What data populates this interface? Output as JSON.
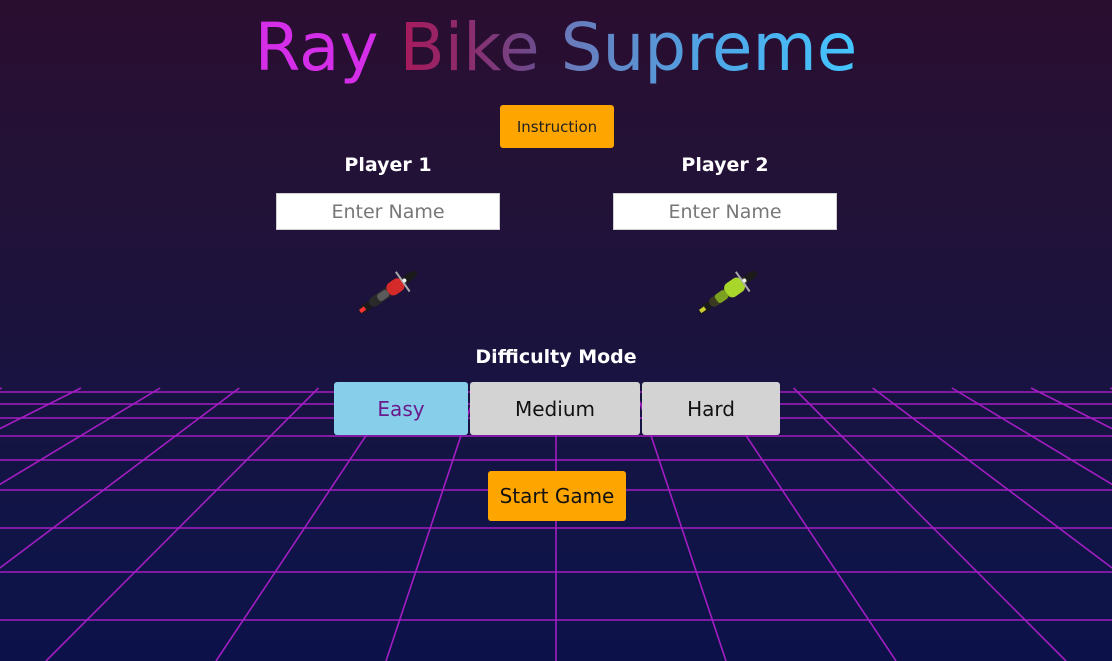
{
  "title": {
    "word1": "Ray",
    "word2": "Bike",
    "word3": "Supreme"
  },
  "instruction_button": "Instruction",
  "players": [
    {
      "label": "Player 1",
      "name_placeholder": "Enter Name",
      "name_value": "",
      "bike_color": "red",
      "bike_icon": "red-motorbike-icon"
    },
    {
      "label": "Player 2",
      "name_placeholder": "Enter Name",
      "name_value": "",
      "bike_color": "green",
      "bike_icon": "green-motorbike-icon"
    }
  ],
  "difficulty": {
    "label": "Difficulty Mode",
    "options": [
      "Easy",
      "Medium",
      "Hard"
    ],
    "selected": "Easy"
  },
  "start_button": "Start Game",
  "colors": {
    "accent_button": "#ffa500",
    "selected_option": "#87ceeb",
    "unselected_option": "#d3d3d3",
    "grid_line": "#b01ec8"
  }
}
